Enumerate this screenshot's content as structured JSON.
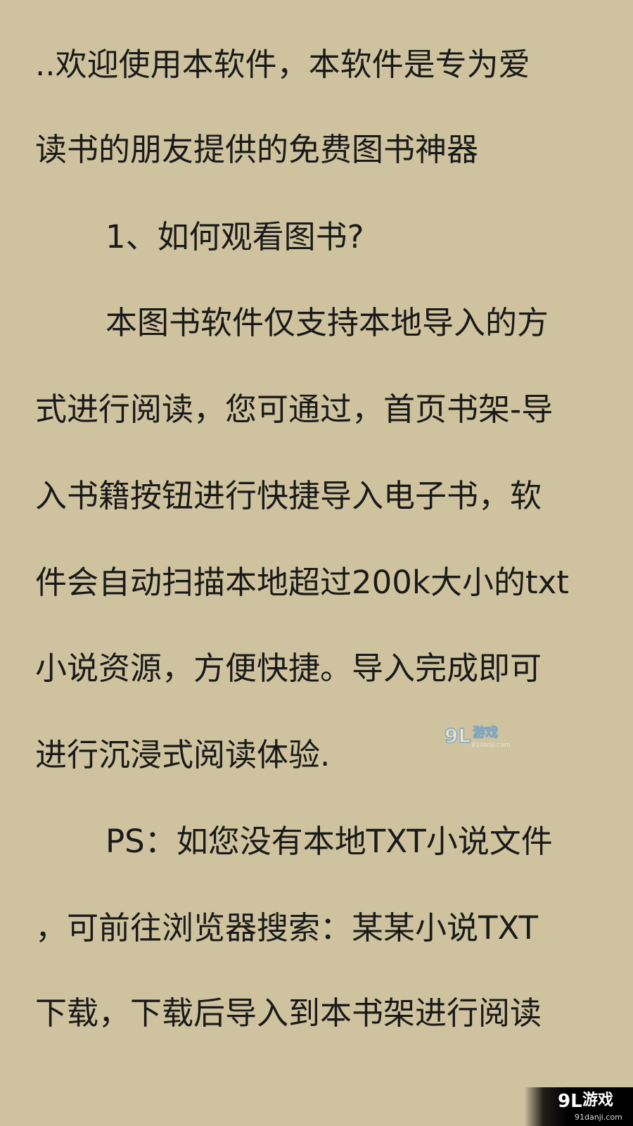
{
  "reader": {
    "paragraph_lines": [
      "..欢迎使用本软件，本软件是专为爱",
      "读书的朋友提供的免费图书神器",
      "1、如何观看图书?",
      "本图书软件仅支持本地导入的方",
      "式进行阅读，您可通过，首页书架-导",
      "入书籍按钮进行快捷导入电子书，软",
      "件会自动扫描本地超过200k大小的txt",
      "小说资源，方便快捷。导入完成即可",
      "进行沉浸式阅读体验.",
      "PS：如您没有本地TXT小说文件",
      "，可前往浏览器搜索：某某小说TXT",
      "下载，下载后导入到本书架进行阅读"
    ]
  },
  "watermark_center": {
    "logo": "9L",
    "name": "游戏",
    "url": "91danji.com"
  },
  "watermark_corner": {
    "logo": "9L",
    "name": "游戏",
    "url": "91danji.com"
  }
}
